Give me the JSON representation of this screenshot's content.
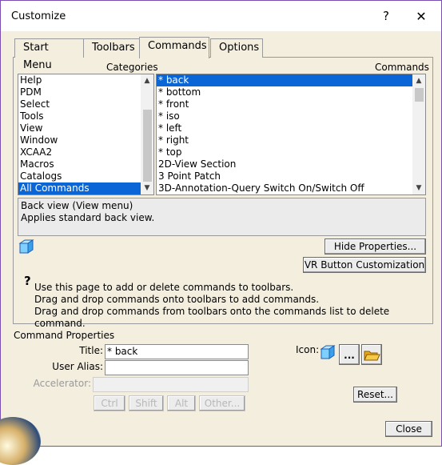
{
  "window": {
    "title": "Customize",
    "help_glyph": "?",
    "close_glyph": "✕"
  },
  "tabs": [
    {
      "label": "Start Menu"
    },
    {
      "label": "Toolbars"
    },
    {
      "label": "Commands",
      "active": true
    },
    {
      "label": "Options"
    }
  ],
  "categories": {
    "label": "Categories",
    "items": [
      "Help",
      "PDM",
      "Select",
      "Tools",
      "View",
      "Window",
      "XCAA2",
      "Macros",
      "Catalogs",
      "All Commands"
    ],
    "selected": "All Commands"
  },
  "commands": {
    "label": "Commands",
    "items": [
      "* back",
      "* bottom",
      "* front",
      "* iso",
      "* left",
      "* right",
      "* top",
      "2D-View Section",
      "3 Point Patch",
      "3D-Annotation-Query Switch On/Switch Off"
    ],
    "selected": "* back"
  },
  "description": {
    "line1": "Back view (View menu)",
    "line2": "Applies standard back view."
  },
  "buttons": {
    "hide_properties": "Hide Properties...",
    "vr_customization": "VR Button Customization",
    "reset": "Reset...",
    "close": "Close",
    "icon_browse": "...",
    "ctrl": "Ctrl",
    "shift": "Shift",
    "alt": "Alt",
    "other": "Other..."
  },
  "help_text": {
    "glyph": "?",
    "line1": "Use this page to add or delete commands to toolbars.",
    "line2": "Drag and drop commands onto toolbars to add commands.",
    "line3": "Drag and drop commands from toolbars onto the commands list to delete command."
  },
  "properties": {
    "group_label": "Command Properties",
    "title_label": "Title:",
    "title_value": "* back",
    "alias_label": "User Alias:",
    "alias_value": "",
    "accel_label": "Accelerator:",
    "accel_value": "",
    "icon_label": "Icon:"
  },
  "colors": {
    "accent_selection": "#0a66d6",
    "dialog_bg": "#f4eedf",
    "frame": "#7a4fb0"
  }
}
